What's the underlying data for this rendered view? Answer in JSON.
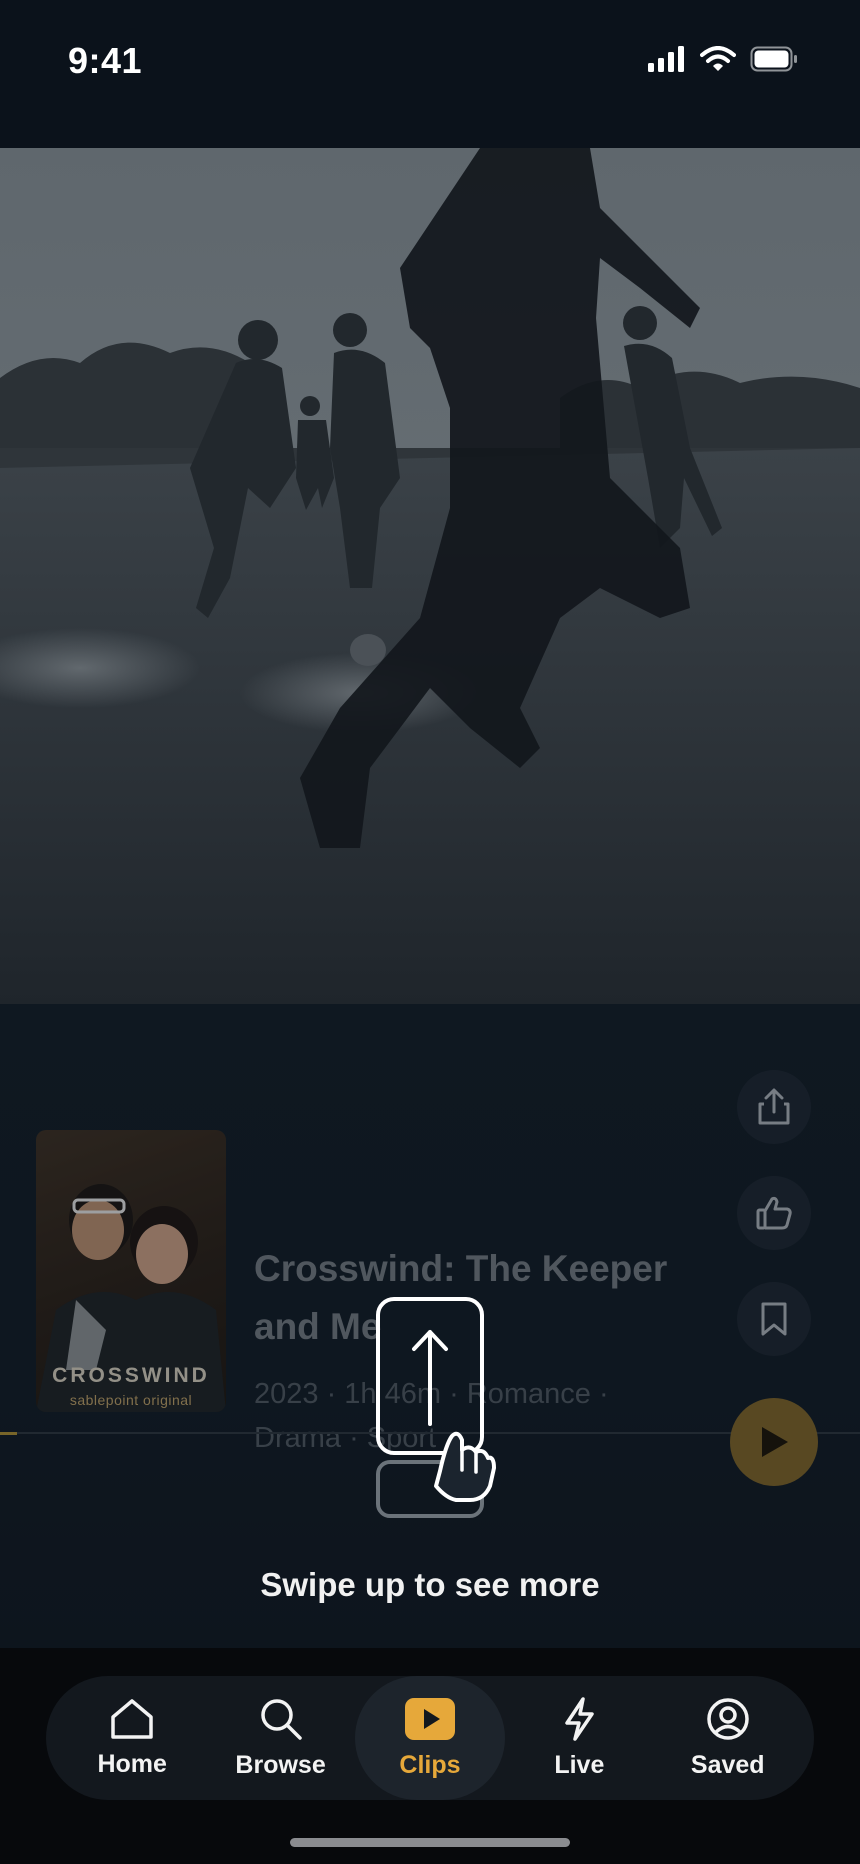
{
  "status_bar": {
    "time": "9:41",
    "icons": [
      "signal-icon",
      "wifi-icon",
      "battery-icon"
    ]
  },
  "clip": {
    "poster": {
      "title": "CROSSWIND",
      "subtitle": "sablepoint original"
    },
    "title": "Crosswind: The Keeper and Me",
    "meta": "2023 · 1h 46m · Romance · Drama · Sport",
    "progress": 0.02,
    "actions": {
      "share_icon": "share-icon",
      "like_icon": "thumbs-up-icon",
      "save_icon": "bookmark-icon",
      "play_icon": "play-icon"
    }
  },
  "onboarding": {
    "swipe_hint": "Swipe up to see more"
  },
  "tab_bar": {
    "tabs": [
      {
        "label": "Home",
        "icon": "home-icon",
        "active": false
      },
      {
        "label": "Browse",
        "icon": "search-icon",
        "active": false
      },
      {
        "label": "Clips",
        "icon": "clips-play-icon",
        "active": true
      },
      {
        "label": "Live",
        "icon": "lightning-icon",
        "active": false
      },
      {
        "label": "Saved",
        "icon": "profile-icon",
        "active": false
      }
    ]
  },
  "colors": {
    "accent": "#E6A83A",
    "background": "#0B1119",
    "panel": "#121C26"
  }
}
